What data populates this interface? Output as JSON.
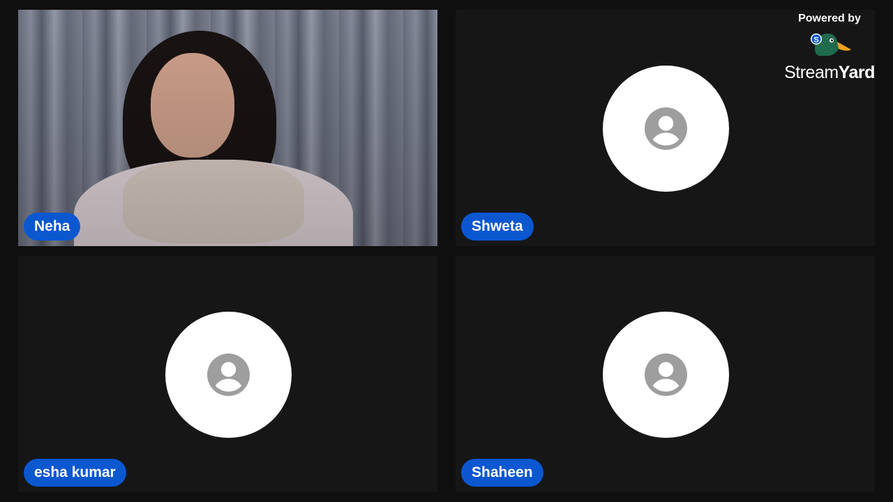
{
  "branding": {
    "powered_label": "Powered by",
    "name_part1": "Stream",
    "name_part2": "Yard",
    "logo_icon": "duck-icon"
  },
  "participants": [
    {
      "name": "Neha",
      "video": true
    },
    {
      "name": "Shweta",
      "video": false
    },
    {
      "name": "esha kumar",
      "video": false
    },
    {
      "name": "Shaheen",
      "video": false
    }
  ],
  "colors": {
    "badge": "#0b57d0",
    "tile": "#161616",
    "background": "#0f0f10"
  }
}
